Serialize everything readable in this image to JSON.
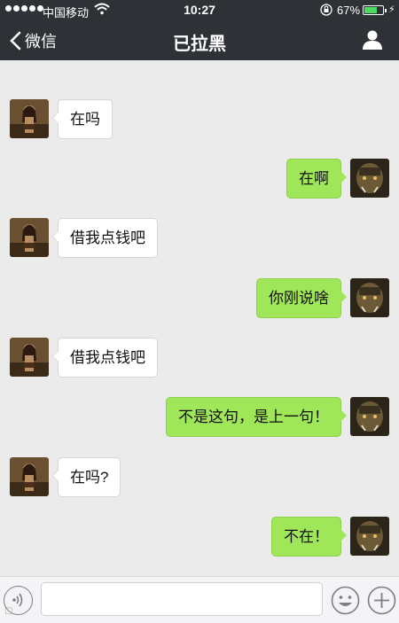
{
  "status_bar": {
    "carrier": "中国移动",
    "time": "10:27",
    "battery_percent": "67%",
    "battery_level": 0.67
  },
  "nav": {
    "back_label": "微信",
    "title": "已拉黑",
    "icons": {
      "back": "chevron-left-icon",
      "profile": "person-icon"
    }
  },
  "messages": [
    {
      "side": "in",
      "text": "在吗"
    },
    {
      "side": "out",
      "text": "在啊"
    },
    {
      "side": "in",
      "text": "借我点钱吧"
    },
    {
      "side": "out",
      "text": "你刚说啥"
    },
    {
      "side": "in",
      "text": "借我点钱吧"
    },
    {
      "side": "out",
      "text": "不是这句，是上一句！"
    },
    {
      "side": "in",
      "text": "在吗?"
    },
    {
      "side": "out",
      "text": "不在！"
    }
  ],
  "input_bar": {
    "text_value": "",
    "icons": {
      "voice": "voice-icon",
      "emoji": "emoji-icon",
      "more": "plus-icon"
    }
  },
  "colors": {
    "header_bg": "#2e3135",
    "chat_bg": "#ebebeb",
    "outgoing_bubble": "#9fe658",
    "incoming_bubble": "#ffffff"
  }
}
